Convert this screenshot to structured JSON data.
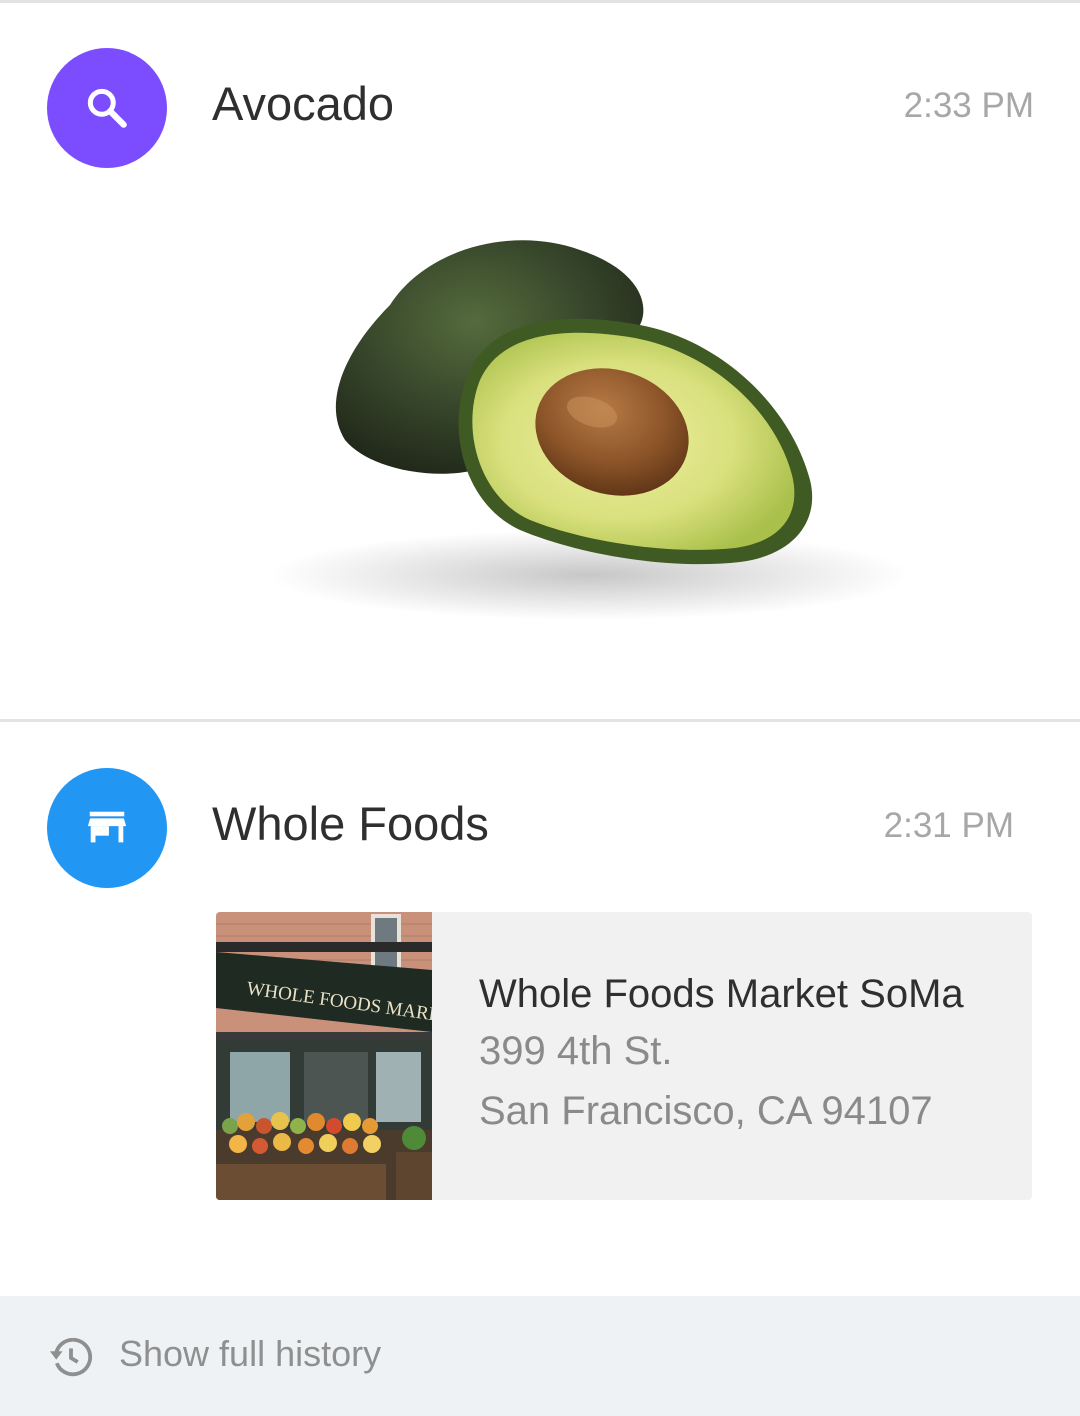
{
  "history": {
    "entries": [
      {
        "title": "Avocado",
        "time": "2:33 PM",
        "icon": "search-icon",
        "avatar_color": "#7c4dff"
      },
      {
        "title": "Whole Foods",
        "time": "2:31 PM",
        "icon": "store-icon",
        "avatar_color": "#2196f3",
        "card": {
          "name": "Whole Foods Market SoMa",
          "address_line1": "399 4th St.",
          "address_line2": "San Francisco, CA 94107",
          "photo_sign": "WHOLE FOODS MARKET"
        }
      }
    ]
  },
  "footer": {
    "label": "Show full history",
    "icon": "history-icon"
  }
}
